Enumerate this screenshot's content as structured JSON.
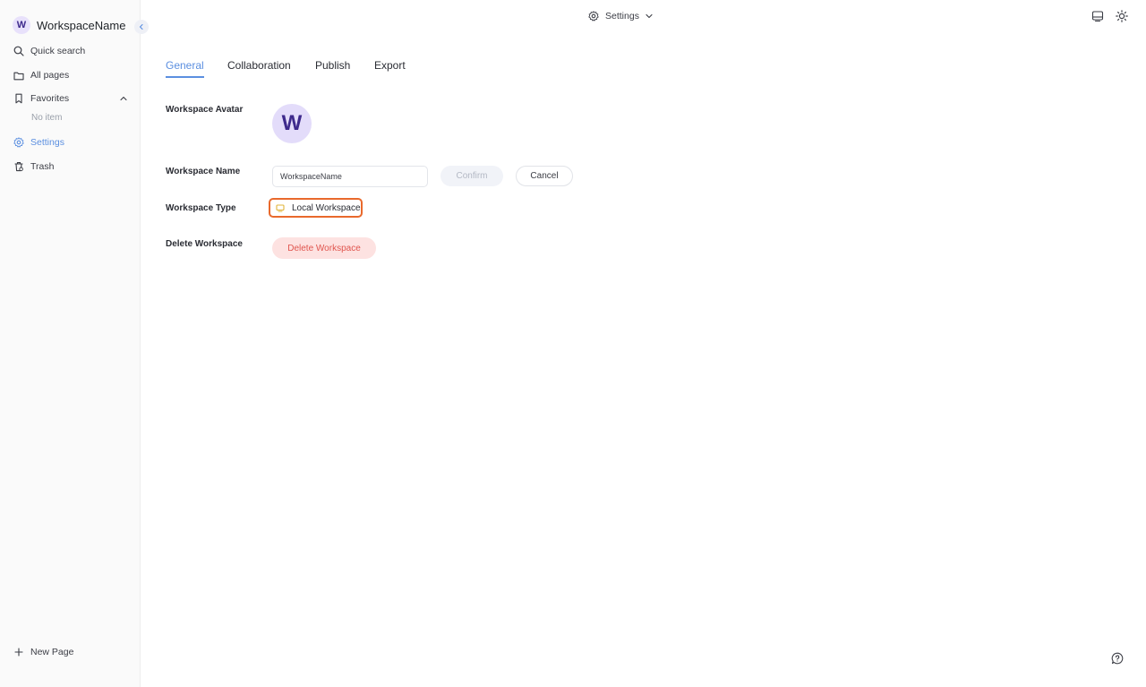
{
  "sidebar": {
    "workspace_initial": "W",
    "workspace_name": "WorkspaceName",
    "items": [
      {
        "label": "Quick search",
        "icon": "search-icon"
      },
      {
        "label": "All pages",
        "icon": "folder-icon"
      },
      {
        "label": "Favorites",
        "icon": "bookmark-icon"
      },
      {
        "label": "Settings",
        "icon": "gear-icon"
      },
      {
        "label": "Trash",
        "icon": "trash-icon"
      }
    ],
    "favorites_empty": "No item",
    "new_page": "New Page"
  },
  "topbar": {
    "title": "Settings"
  },
  "tabs": [
    "General",
    "Collaboration",
    "Publish",
    "Export"
  ],
  "settings": {
    "avatar_label": "Workspace Avatar",
    "avatar_initial": "W",
    "name_label": "Workspace Name",
    "name_value": "WorkspaceName",
    "confirm": "Confirm",
    "cancel": "Cancel",
    "type_label": "Workspace Type",
    "type_value": "Local Workspace",
    "delete_label": "Delete Workspace",
    "delete_button": "Delete Workspace"
  },
  "colors": {
    "accent": "#5b8fe0",
    "danger": "#e0554e",
    "focus": "#e9692c",
    "avatar_bg": "#e3dcfa"
  }
}
